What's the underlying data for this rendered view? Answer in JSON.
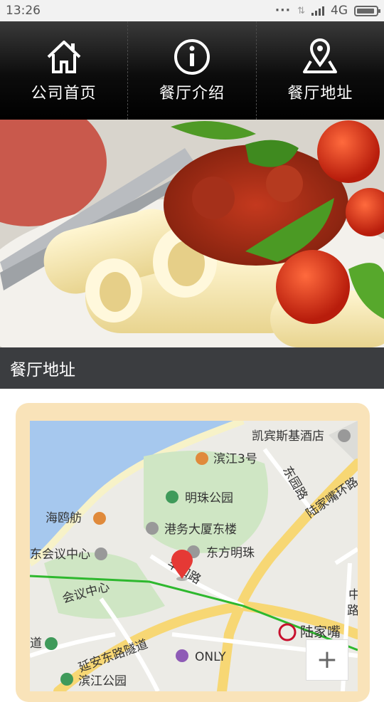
{
  "status": {
    "time": "13:26",
    "network": "4G"
  },
  "nav": {
    "items": [
      {
        "label": "公司首页",
        "icon": "home-icon"
      },
      {
        "label": "餐厅介绍",
        "icon": "info-icon"
      },
      {
        "label": "餐厅地址",
        "icon": "location-pin-icon"
      }
    ]
  },
  "banner": {
    "caption": "餐厅地址"
  },
  "map": {
    "labels": {
      "kempinski": "凯宾斯基酒店",
      "binjiang3": "滨江3号",
      "dongyuan_road": "东园路",
      "lujiazui_ring": "陆家嘴环路",
      "mingzhu_park": "明珠公园",
      "haiou": "海鸥舫",
      "port_building": "港务大厦东楼",
      "conference_center": "东会议中心",
      "oriental_pearl": "东方明珠",
      "conference_center_2": "会议中心",
      "fenghe_road": "丰和路",
      "yanan_tunnel": "延安东路隧道",
      "lujiazui_station": "陆家嘴",
      "only": "ONLY",
      "binjiang_park": "滨江公园",
      "dao": "道",
      "zhong": "中",
      "lu": "路"
    },
    "zoom_in": "+"
  },
  "colors": {
    "nav_bg": "#000000",
    "caption_bg": "#3b3d40",
    "card_bg": "#f9e3b9",
    "pin": "#e53935",
    "metro": "#2eb82e"
  }
}
